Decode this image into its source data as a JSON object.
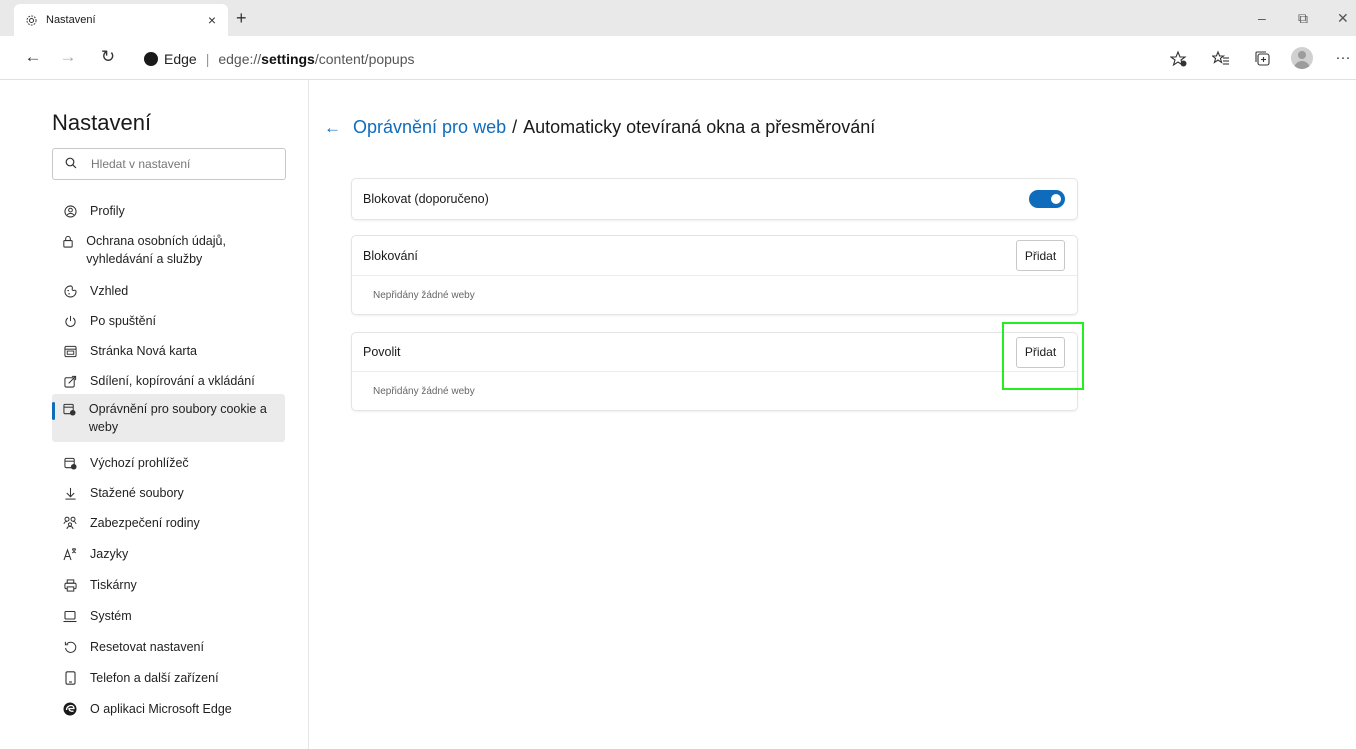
{
  "browser": {
    "tab_title": "Nastavení",
    "tab_close": "×",
    "new_tab": "+",
    "window_controls": {
      "minimize": "–",
      "restore": "⧉",
      "close": "✕"
    },
    "nav": {
      "back": "←",
      "forward": "→",
      "refresh": "↻"
    },
    "address": {
      "badge_text": "Edge",
      "separator": "|",
      "url_prefix": "edge://",
      "url_strong": "settings",
      "url_suffix": "/content/popups"
    },
    "more": "···"
  },
  "sidebar": {
    "title": "Nastavení",
    "search_placeholder": "Hledat v nastavení",
    "items": [
      {
        "label": "Profily",
        "icon": "profile-icon"
      },
      {
        "label": "Ochrana osobních údajů, vyhledávání a služby",
        "icon": "lock-icon"
      },
      {
        "label": "Vzhled",
        "icon": "appearance-icon"
      },
      {
        "label": "Po spuštění",
        "icon": "power-icon"
      },
      {
        "label": "Stránka Nová karta",
        "icon": "new-tab-page-icon"
      },
      {
        "label": "Sdílení, kopírování a vkládání",
        "icon": "share-icon"
      },
      {
        "label": "Oprávnění pro soubory cookie a weby",
        "icon": "cookie-site-permissions-icon",
        "active": true
      },
      {
        "label": "Výchozí prohlížeč",
        "icon": "default-browser-icon"
      },
      {
        "label": "Stažené soubory",
        "icon": "download-icon"
      },
      {
        "label": "Zabezpečení rodiny",
        "icon": "family-icon"
      },
      {
        "label": "Jazyky",
        "icon": "languages-icon"
      },
      {
        "label": "Tiskárny",
        "icon": "printer-icon"
      },
      {
        "label": "Systém",
        "icon": "laptop-icon"
      },
      {
        "label": "Resetovat nastavení",
        "icon": "reset-icon"
      },
      {
        "label": "Telefon a další zařízení",
        "icon": "phone-icon"
      },
      {
        "label": "O aplikaci Microsoft Edge",
        "icon": "edge-logo-icon"
      }
    ]
  },
  "main": {
    "back_arrow": "←",
    "crumb_link": "Oprávnění pro web",
    "crumb_sep": "/",
    "crumb_current": "Automaticky otevíraná okna a přesměrování",
    "block_toggle": {
      "label": "Blokovat (doporučeno)",
      "on": true
    },
    "block_section": {
      "title": "Blokování",
      "add_label": "Přidat",
      "empty_text": "Nepřidány žádné weby"
    },
    "allow_section": {
      "title": "Povolit",
      "add_label": "Přidat",
      "empty_text": "Nepřidány žádné weby"
    }
  },
  "colors": {
    "accent": "#0f6cbd",
    "highlight": "#22ee22"
  }
}
